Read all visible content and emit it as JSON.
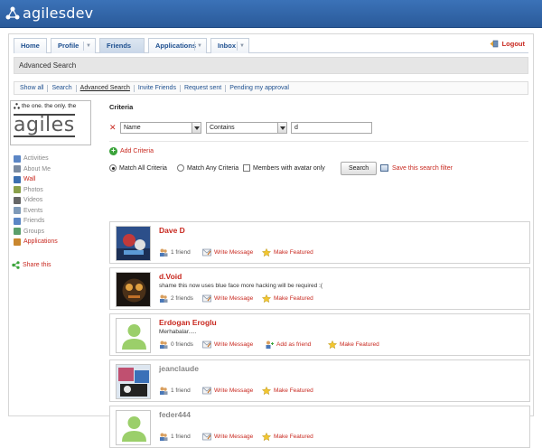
{
  "brand": {
    "name": "agilesdev"
  },
  "nav": {
    "tabs": [
      {
        "label": "Home",
        "dropdown": false
      },
      {
        "label": "Profile",
        "dropdown": true
      },
      {
        "label": "Friends",
        "dropdown": false,
        "active": true
      },
      {
        "label": "Applications",
        "dropdown": true
      },
      {
        "label": "Inbox",
        "dropdown": true
      }
    ],
    "logout": "Logout"
  },
  "page": {
    "title": "Advanced Search"
  },
  "subnav": {
    "items": [
      "Show all",
      "Search",
      "Advanced Search",
      "Invite Friends",
      "Request sent",
      "Pending my approval"
    ],
    "current": "Advanced Search"
  },
  "profile": {
    "tagline": "the one. the only. the",
    "word": "agiles"
  },
  "sidebar": {
    "items": [
      {
        "label": "Activities",
        "icon": "activities-icon",
        "color": "#5b86c5",
        "red": false
      },
      {
        "label": "About Me",
        "icon": "about-me-icon",
        "color": "#7a8aa0",
        "red": false
      },
      {
        "label": "Wall",
        "icon": "wall-icon",
        "color": "#3c6fb0",
        "red": true
      },
      {
        "label": "Photos",
        "icon": "photos-icon",
        "color": "#8aa04a",
        "red": false
      },
      {
        "label": "Videos",
        "icon": "videos-icon",
        "color": "#666666",
        "red": false
      },
      {
        "label": "Events",
        "icon": "events-icon",
        "color": "#7f9ab8",
        "red": false
      },
      {
        "label": "Friends",
        "icon": "friends-icon",
        "color": "#5b86c5",
        "red": false
      },
      {
        "label": "Groups",
        "icon": "groups-icon",
        "color": "#5a9f6b",
        "red": false
      },
      {
        "label": "Applications",
        "icon": "applications-icon",
        "color": "#c9872e",
        "red": true
      }
    ],
    "share": "Share this"
  },
  "criteria": {
    "title": "Criteria",
    "field": "Name",
    "condition": "Contains",
    "value": "d",
    "add_label": "Add Criteria",
    "match_all": "Match All Criteria",
    "match_any": "Match Any Criteria",
    "avatar_only": "Members with avatar only",
    "search_button": "Search",
    "save_filter": "Save this search filter"
  },
  "results": [
    {
      "name": "Dave D",
      "status": "",
      "friends": "1 friend",
      "message": "Write Message",
      "add": "",
      "featured": "Make Featured",
      "name_color": "red",
      "thumb": "art-blue"
    },
    {
      "name": "d.Void",
      "status": "shame this now uses blue face more hacking will be required :(",
      "friends": "2 friends",
      "message": "Write Message",
      "add": "",
      "featured": "Make Featured",
      "name_color": "red",
      "thumb": "art-dark"
    },
    {
      "name": "Erdogan Eroglu",
      "status": "Merhabalar.....",
      "friends": "0 friends",
      "message": "Write Message",
      "add": "Add as friend",
      "featured": "Make Featured",
      "name_color": "red",
      "thumb": "default"
    },
    {
      "name": "jeanclaude",
      "status": "",
      "friends": "1 friend",
      "message": "Write Message",
      "add": "",
      "featured": "Make Featured",
      "name_color": "gray",
      "thumb": "art-mixed"
    },
    {
      "name": "feder444",
      "status": "",
      "friends": "1 friend",
      "message": "Write Message",
      "add": "",
      "featured": "Make Featured",
      "name_color": "gray",
      "thumb": "default"
    }
  ]
}
